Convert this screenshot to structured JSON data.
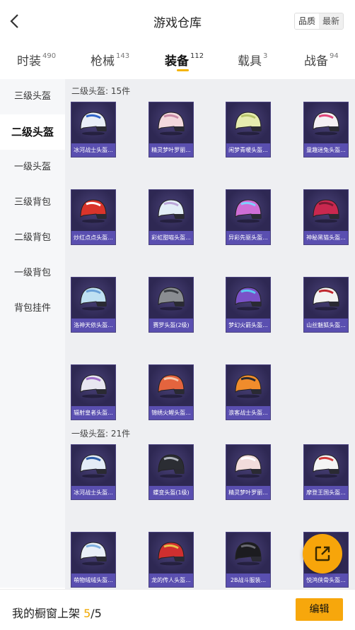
{
  "header": {
    "title": "游戏仓库",
    "sort_quality": "品质",
    "sort_latest": "最新"
  },
  "tabs": [
    {
      "label": "时装",
      "count": "490"
    },
    {
      "label": "枪械",
      "count": "143"
    },
    {
      "label": "装备",
      "count": "112",
      "active": true
    },
    {
      "label": "载具",
      "count": "3"
    },
    {
      "label": "战备",
      "count": "94"
    }
  ],
  "sidebar": {
    "items": [
      "三级头盔",
      "二级头盔",
      "一级头盔",
      "三级背包",
      "二级背包",
      "一级背包",
      "背包挂件"
    ],
    "active": 1
  },
  "sections": [
    {
      "title": "二级头盔: 15件",
      "items": [
        {
          "name": "冰河战士头盔...",
          "color": "#e9eef7",
          "accent": "#2f64c8"
        },
        {
          "name": "精灵梦叶罗丽...",
          "color": "#f3d9dd",
          "accent": "#c98aa5"
        },
        {
          "name": "闲梦青暖头盔...",
          "color": "#e6ecb0",
          "accent": "#b7c46a"
        },
        {
          "name": "童趣迷兔头盔...",
          "color": "#f4f0f4",
          "accent": "#e0467a"
        },
        {
          "name": "炒红点点头盔...",
          "color": "#d9342b",
          "accent": "#ffffff"
        },
        {
          "name": "彩虹甜喵头盔...",
          "color": "#e3eef7",
          "accent": "#bba7d8"
        },
        {
          "name": "异彩先驱头盔...",
          "color": "#cf6ed6",
          "accent": "#7ed0ff"
        },
        {
          "name": "神秘黑猫头盔...",
          "color": "#c9284f",
          "accent": "#7a1a33"
        },
        {
          "name": "洛神天依头盔...",
          "color": "#bfe0f2",
          "accent": "#6aa0d8"
        },
        {
          "name": "赛罗头盔(2级)",
          "color": "#8a8d92",
          "accent": "#3a3d42"
        },
        {
          "name": "梦幻火箭头盔...",
          "color": "#7a52c8",
          "accent": "#5ac8f0"
        },
        {
          "name": "山丝魅狐头盔...",
          "color": "#f2f2f2",
          "accent": "#c0282e"
        },
        {
          "name": "辐射皇者头盔...",
          "color": "#e8e6f0",
          "accent": "#a06fc8"
        },
        {
          "name": "锦绣火鲤头盔...",
          "color": "#e4643e",
          "accent": "#f5c6a8"
        },
        {
          "name": "浪客战士头盔...",
          "color": "#f08c2c",
          "accent": "#2a2a30"
        }
      ]
    },
    {
      "title": "一级头盔: 21件",
      "items": [
        {
          "name": "冰河战士头盔...",
          "color": "#e4ecf6",
          "accent": "#2e5ea8"
        },
        {
          "name": "蝶变头盔(1级)",
          "color": "#2b2d33",
          "accent": "#b0b4bc"
        },
        {
          "name": "精灵梦叶罗丽...",
          "color": "#f2dcdc",
          "accent": "#ffffff"
        },
        {
          "name": "摩登王国头盔...",
          "color": "#f4f4f4",
          "accent": "#d03a3a"
        },
        {
          "name": "萌物绒绒头盔...",
          "color": "#e9eff8",
          "accent": "#7fb0e0"
        },
        {
          "name": "龙的传人头盔...",
          "color": "#cf2f2f",
          "accent": "#e8c04a"
        },
        {
          "name": "2B战斗服装...",
          "color": "#1c1c20",
          "accent": "#6a6a72"
        },
        {
          "name": "悦鸿侠骨头盔...",
          "color": "#eae8f0",
          "accent": "#9a8ac8"
        }
      ]
    }
  ],
  "footer": {
    "label": "我的橱窗上架 ",
    "current": "5",
    "total": "/5",
    "edit": "编辑"
  },
  "fab": {
    "icon": "share-external-icon"
  }
}
